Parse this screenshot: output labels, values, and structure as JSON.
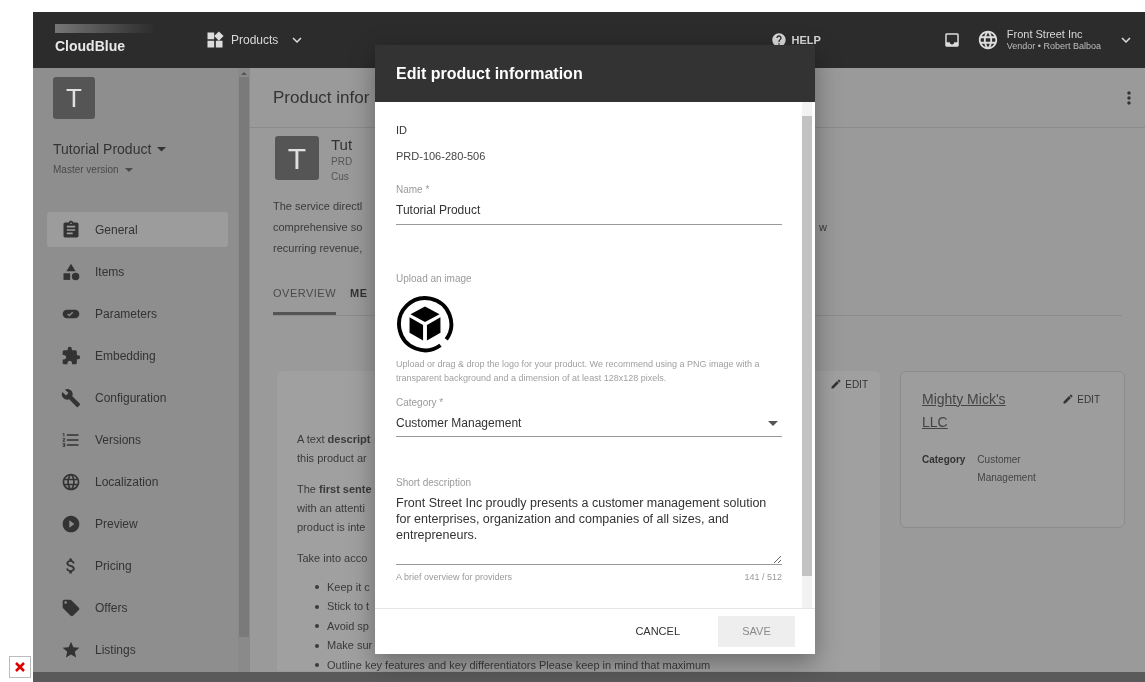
{
  "top_bar": {
    "logo": "CloudBlue",
    "menu": "Products",
    "help": "HELP",
    "account": {
      "name": "Front Street Inc",
      "role": "Vendor • Robert Balboa"
    }
  },
  "sidebar": {
    "avatar": "T",
    "product": "Tutorial Product",
    "version": "Master version",
    "items": [
      {
        "label": "General",
        "selected": true
      },
      {
        "label": "Items",
        "selected": false
      },
      {
        "label": "Parameters",
        "selected": false
      },
      {
        "label": "Embedding",
        "selected": false
      },
      {
        "label": "Configuration",
        "selected": false
      },
      {
        "label": "Versions",
        "selected": false
      },
      {
        "label": "Localization",
        "selected": false
      },
      {
        "label": "Preview",
        "selected": false
      },
      {
        "label": "Pricing",
        "selected": false
      },
      {
        "label": "Offers",
        "selected": false
      },
      {
        "label": "Listings",
        "selected": false
      }
    ]
  },
  "page": {
    "title": "Product infor",
    "product": {
      "avatar": "T",
      "name": "Tut",
      "id": "PRD",
      "category": "Cus"
    },
    "description": [
      "The service directl",
      "comprehensive so",
      "recurring revenue,"
    ],
    "description_tail": "w",
    "tabs": [
      {
        "label": "OVERVIEW",
        "selected": true
      },
      {
        "label": "ME",
        "selected": false
      }
    ],
    "overview": {
      "edit": "EDIT",
      "paragraphs": [
        [
          "A text **descript**",
          "this product ar"
        ],
        [
          "The **first sente**",
          "with an attenti",
          "product is inte"
        ],
        [
          "Take into acco"
        ]
      ],
      "bullets": [
        "Keep it c",
        "Stick to t",
        "Avoid sp",
        "Make sur",
        "Outline key features and key differentiators Please keep in mind that maximum"
      ]
    },
    "vendor_card": {
      "name": "Mighty Mick's LLC",
      "edit": "EDIT",
      "field_label": "Category",
      "field_value": "Customer Management"
    }
  },
  "dialog": {
    "title": "Edit product information",
    "id_label": "ID",
    "id_value": "PRD-106-280-506",
    "name": {
      "label": "Name *",
      "value": "Tutorial Product"
    },
    "upload": {
      "label": "Upload an image",
      "hint": "Upload or drag & drop the logo for your product. We recommend using a PNG image with a transparent background and a dimension of at least 128x128 pixels."
    },
    "category": {
      "label": "Category *",
      "value": "Customer Management"
    },
    "short_description": {
      "label": "Short description",
      "value": "Front Street Inc proudly presents a customer management solution for enterprises, organization and companies of all sizes, and entrepreneurs.",
      "helper": "A brief overview for providers",
      "counter": "141 / 512"
    },
    "buttons": [
      {
        "label": "CANCEL",
        "kind": "text",
        "disabled": false
      },
      {
        "label": "SAVE",
        "kind": "filled",
        "disabled": true
      }
    ]
  }
}
